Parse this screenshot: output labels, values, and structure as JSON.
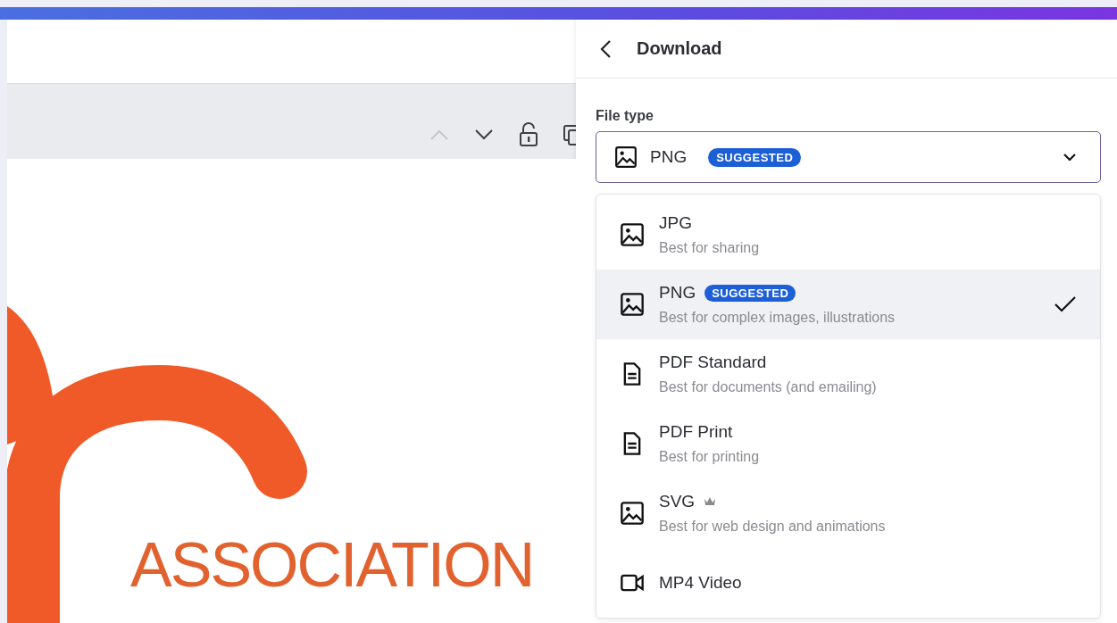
{
  "canvas": {
    "logo_text": "ASSOCIATION"
  },
  "panel": {
    "title": "Download",
    "file_type_label": "File type",
    "select": {
      "value": "PNG",
      "kind": "image",
      "badge": "SUGGESTED"
    },
    "options": [
      {
        "name": "JPG",
        "description": "Best for sharing",
        "kind": "image",
        "selected": false,
        "premium": false
      },
      {
        "name": "PNG",
        "badge": "SUGGESTED",
        "description": "Best for complex images, illustrations",
        "kind": "image",
        "selected": true,
        "premium": false
      },
      {
        "name": "PDF Standard",
        "description": "Best for documents (and emailing)",
        "kind": "document",
        "selected": false,
        "premium": false
      },
      {
        "name": "PDF Print",
        "description": "Best for printing",
        "kind": "document",
        "selected": false,
        "premium": false
      },
      {
        "name": "SVG",
        "description": "Best for web design and animations",
        "kind": "image",
        "selected": false,
        "premium": true
      },
      {
        "name": "MP4 Video",
        "kind": "video",
        "selected": false,
        "premium": false
      }
    ]
  }
}
